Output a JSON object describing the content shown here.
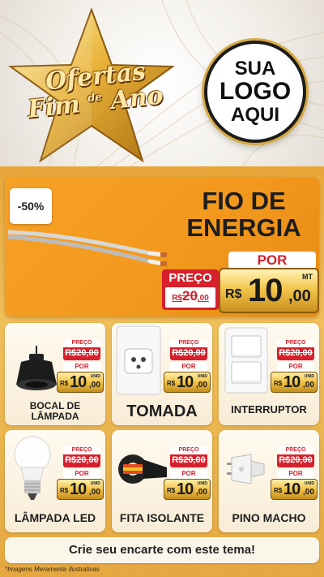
{
  "header": {
    "title_line1": "Ofertas",
    "title_line2_a": "Fim",
    "title_line2_de": "de",
    "title_line2_b": "Ano",
    "logo_line1": "SUA",
    "logo_line2": "LOGO",
    "logo_line3": "AQUI"
  },
  "featured": {
    "discount": "-50%",
    "name_line1": "FIO DE",
    "name_line2": "ENERGIA",
    "por_label": "POR",
    "preco_label": "PREÇO",
    "old_currency": "R$",
    "old_int": "20",
    "old_dec": ",00",
    "currency": "R$",
    "price_int": "10",
    "price_dec": ",00",
    "unit": "MT"
  },
  "products": [
    {
      "name": "BOCAL DE LÂMPADA",
      "preco_label": "PREÇO",
      "old": "R$20,00",
      "por_label": "POR",
      "currency": "R$",
      "int": "10",
      "dec": ",00",
      "unit": "UNID",
      "icon": "bulb-socket-icon"
    },
    {
      "name": "TOMADA",
      "preco_label": "PREÇO",
      "old": "R$20,00",
      "por_label": "POR",
      "currency": "R$",
      "int": "10",
      "dec": ",00",
      "unit": "UNID",
      "icon": "outlet-icon"
    },
    {
      "name": "INTERRUPTOR",
      "preco_label": "PREÇO",
      "old": "R$20,00",
      "por_label": "POR",
      "currency": "R$",
      "int": "10",
      "dec": ",00",
      "unit": "UNID",
      "icon": "light-switch-icon"
    },
    {
      "name": "LÂMPADA LED",
      "preco_label": "PREÇO",
      "old": "R$20,00",
      "por_label": "POR",
      "currency": "R$",
      "int": "10",
      "dec": ",00",
      "unit": "UNID",
      "icon": "led-bulb-icon"
    },
    {
      "name": "FITA ISOLANTE",
      "preco_label": "PREÇO",
      "old": "R$20,00",
      "por_label": "POR",
      "currency": "R$",
      "int": "10",
      "dec": ",00",
      "unit": "UNID",
      "icon": "insulating-tape-icon"
    },
    {
      "name": "PINO MACHO",
      "preco_label": "PREÇO",
      "old": "R$20,00",
      "por_label": "POR",
      "currency": "R$",
      "int": "10",
      "dec": ",00",
      "unit": "UNID",
      "icon": "plug-icon"
    }
  ],
  "footer": {
    "cta": "Crie seu encarte com este tema!",
    "disclaimer": "*Imagens Meramente Ilustrativas"
  },
  "colors": {
    "accent_orange": "#f39a1e",
    "price_red": "#d6202b",
    "gold": "#f1c248"
  }
}
